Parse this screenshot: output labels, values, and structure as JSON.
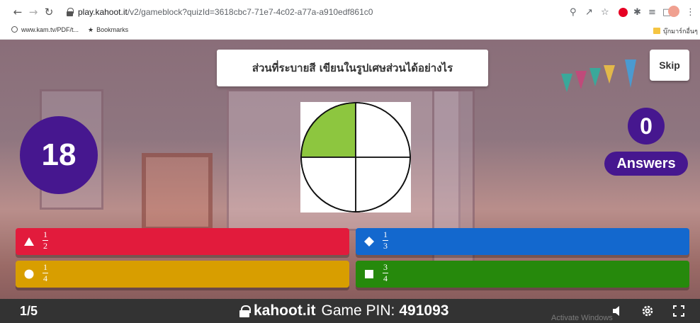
{
  "browser": {
    "url_host": "play.kahoot.it",
    "url_path": "/v2/gameblock?quizId=3618cbc7-71e7-4c02-a77a-a910edf861c0",
    "bookmarks": [
      {
        "label": "www.kam.tv/PDF/t..."
      },
      {
        "label": "Bookmarks"
      }
    ],
    "other_bookmarks": "บุ๊กมาร์กอื่นๆ"
  },
  "game": {
    "question": "ส่วนที่ระบายสี เขียนในรูปเศษส่วนได้อย่างไร",
    "skip_label": "Skip",
    "timer": "18",
    "answers_count": "0",
    "answers_label": "Answers",
    "figure": {
      "parts": 4,
      "shaded": 1,
      "shade_color": "#8dc63f"
    },
    "choices": [
      {
        "shape": "triangle-icon",
        "color": "#e21b3c",
        "numerator": "1",
        "denominator": "2"
      },
      {
        "shape": "diamond-icon",
        "color": "#1368ce",
        "numerator": "1",
        "denominator": "3"
      },
      {
        "shape": "circle-icon",
        "color": "#d89e00",
        "numerator": "1",
        "denominator": "4"
      },
      {
        "shape": "square-icon",
        "color": "#26890c",
        "numerator": "3",
        "denominator": "4"
      }
    ]
  },
  "footer": {
    "counter": "1/5",
    "site": "kahoot.it",
    "pin_label": "Game PIN:",
    "pin": "491093",
    "watermark": "Activate Windows"
  }
}
